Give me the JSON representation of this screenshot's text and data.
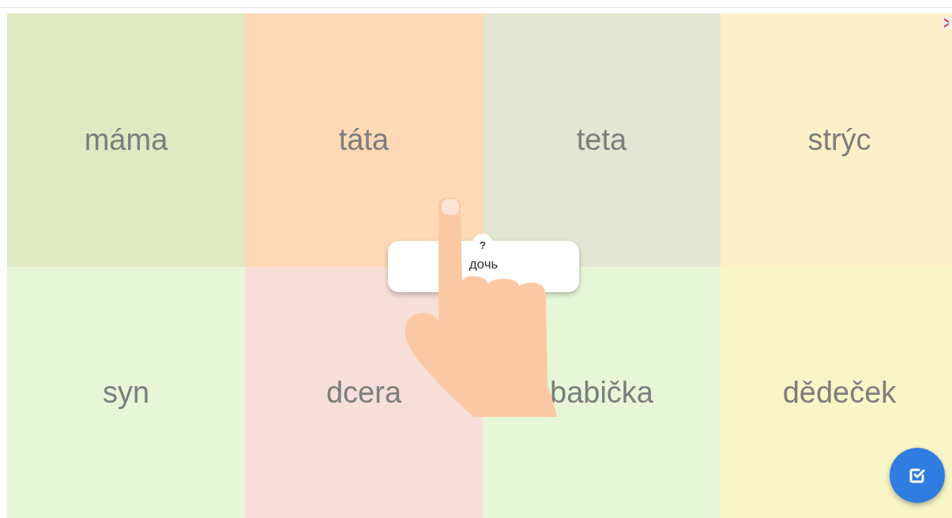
{
  "tiles": [
    {
      "word": "máma",
      "color": "#dfe9c3"
    },
    {
      "word": "táta",
      "color": "#fdd9b6"
    },
    {
      "word": "teta",
      "color": "#e3e6d2"
    },
    {
      "word": "strýc",
      "color": "#fdf0c8"
    },
    {
      "word": "syn",
      "color": "#e7f6d7"
    },
    {
      "word": "dcera",
      "color": "#f7ded8"
    },
    {
      "word": "babička",
      "color": "#e7f6d7"
    },
    {
      "word": "dědeček",
      "color": "#f8f5c6"
    }
  ],
  "prompt_card": {
    "badge": "?",
    "word": "дочь"
  }
}
